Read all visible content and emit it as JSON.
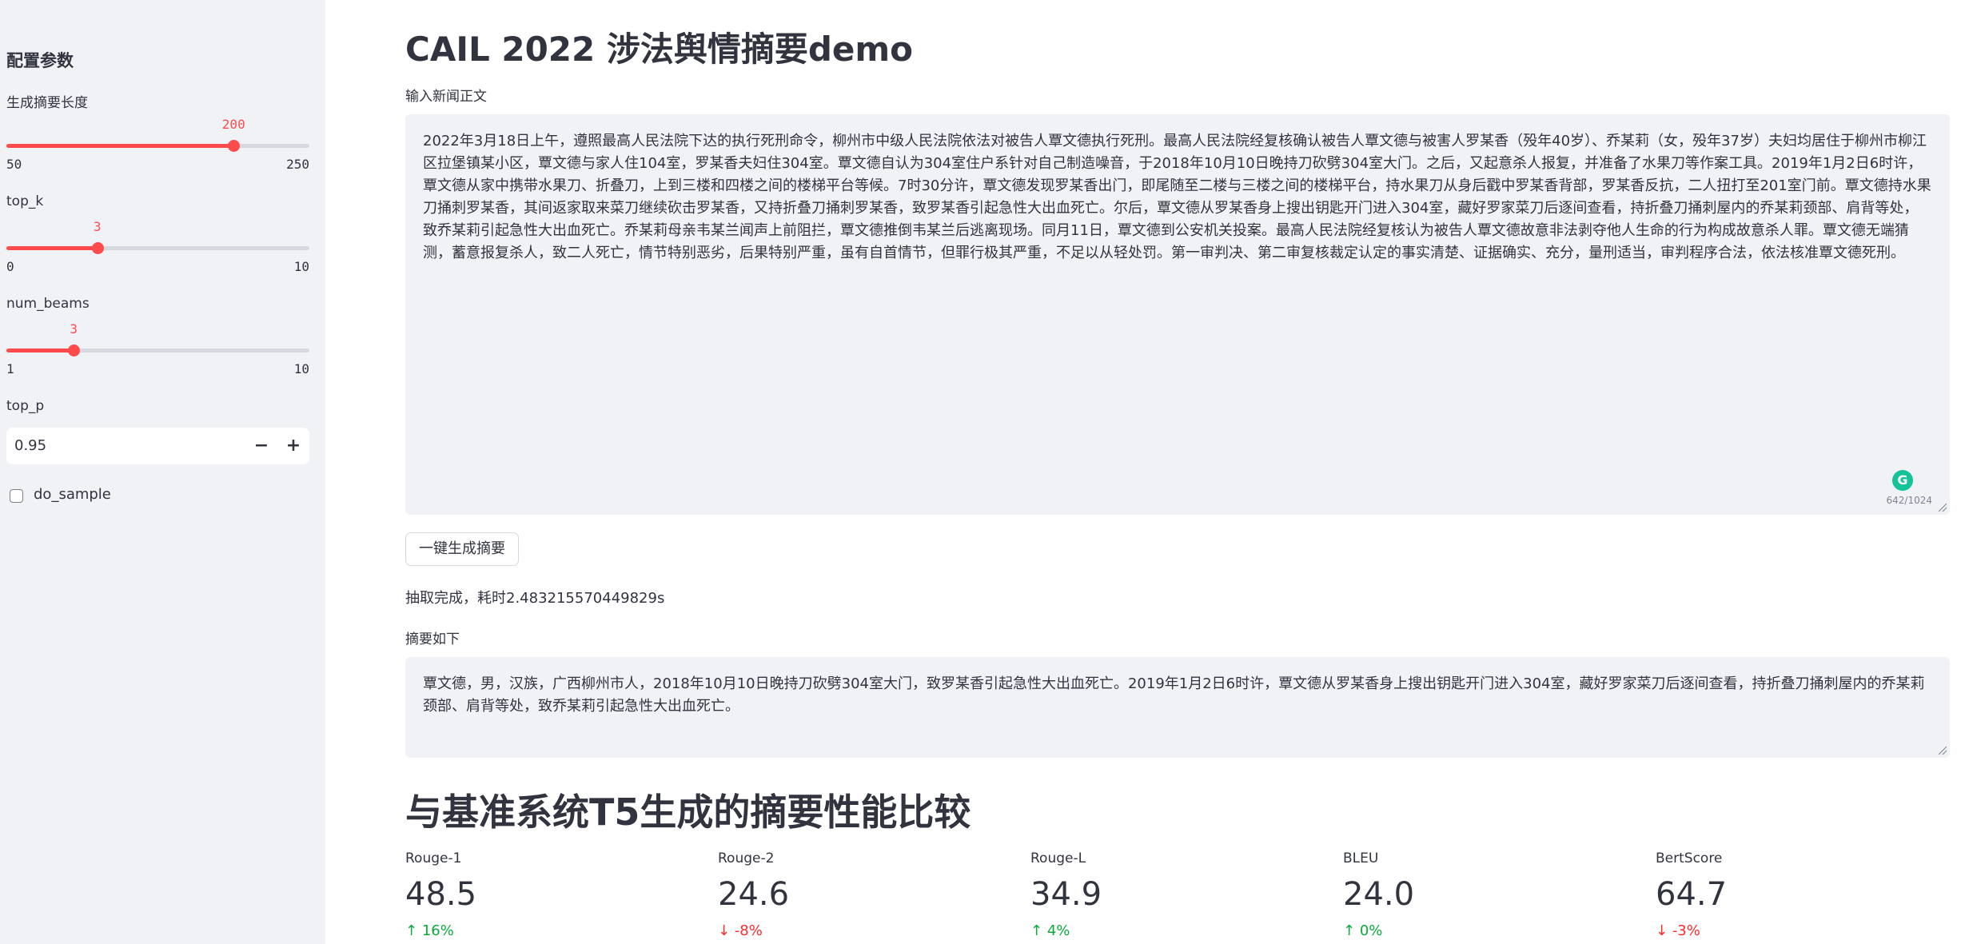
{
  "sidebar": {
    "title": "配置参数",
    "summary_length": {
      "label": "生成摘要长度",
      "min": 50,
      "max": 250,
      "value": 200
    },
    "top_k": {
      "label": "top_k",
      "min": 0,
      "max": 10,
      "value": 3
    },
    "num_beams": {
      "label": "num_beams",
      "min": 1,
      "max": 10,
      "value": 3
    },
    "top_p": {
      "label": "top_p",
      "value": "0.95",
      "minus": "−",
      "plus": "+"
    },
    "do_sample": {
      "label": "do_sample",
      "checked": false
    }
  },
  "main": {
    "title": "CAIL 2022 涉法舆情摘要demo",
    "input_label": "输入新闻正文",
    "input_text": "2022年3月18日上午，遵照最高人民法院下达的执行死刑命令，柳州市中级人民法院依法对被告人覃文德执行死刑。最高人民法院经复核确认被告人覃文德与被害人罗某香（殁年40岁）、乔某莉（女，殁年37岁）夫妇均居住于柳州市柳江区拉堡镇某小区，覃文德与家人住104室，罗某香夫妇住304室。覃文德自认为304室住户系针对自己制造噪音，于2018年10月10日晚持刀砍劈304室大门。之后，又起意杀人报复，并准备了水果刀等作案工具。2019年1月2日6时许，覃文德从家中携带水果刀、折叠刀，上到三楼和四楼之间的楼梯平台等候。7时30分许，覃文德发现罗某香出门，即尾随至二楼与三楼之间的楼梯平台，持水果刀从身后戳中罗某香背部，罗某香反抗，二人扭打至201室门前。覃文德持水果刀捅刺罗某香，其间返家取来菜刀继续砍击罗某香，又持折叠刀捅刺罗某香，致罗某香引起急性大出血死亡。尔后，覃文德从罗某香身上搜出钥匙开门进入304室，藏好罗家菜刀后逐间查看，持折叠刀捅刺屋内的乔某莉颈部、肩背等处，致乔某莉引起急性大出血死亡。乔某莉母亲韦某兰闻声上前阻拦，覃文德推倒韦某兰后逃离现场。同月11日，覃文德到公安机关投案。最高人民法院经复核认为被告人覃文德故意非法剥夺他人生命的行为构成故意杀人罪。覃文德无端猜测，蓄意报复杀人，致二人死亡，情节特别恶劣，后果特别严重，虽有自首情节，但罪行极其严重，不足以从轻处罚。第一审判决、第二审复核裁定认定的事实清楚、证据确实、充分，量刑适当，审判程序合法，依法核准覃文德死刑。",
    "char_counter": "642/1024",
    "generate_button": "一键生成摘要",
    "status_text": "抽取完成，耗时2.483215570449829s",
    "summary_label": "摘要如下",
    "summary_text": "覃文德，男，汉族，广西柳州市人，2018年10月10日晚持刀砍劈304室大门，致罗某香引起急性大出血死亡。2019年1月2日6时许，覃文德从罗某香身上搜出钥匙开门进入304室，藏好罗家菜刀后逐间查看，持折叠刀捅刺屋内的乔某莉颈部、肩背等处，致乔某莉引起急性大出血死亡。",
    "compare_title": "与基准系统T5生成的摘要性能比较",
    "metrics": [
      {
        "label": "Rouge-1",
        "value": "48.5",
        "delta": "16%",
        "direction": "up"
      },
      {
        "label": "Rouge-2",
        "value": "24.6",
        "delta": "-8%",
        "direction": "down"
      },
      {
        "label": "Rouge-L",
        "value": "34.9",
        "delta": "4%",
        "direction": "up"
      },
      {
        "label": "BLEU",
        "value": "24.0",
        "delta": "0%",
        "direction": "up"
      },
      {
        "label": "BertScore",
        "value": "64.7",
        "delta": "-3%",
        "direction": "down"
      }
    ]
  },
  "colors": {
    "accent": "#ff4b4b",
    "sidebar_bg": "#f0f2f6",
    "delta_up": "#09ab3b",
    "delta_down": "#ff2b2b",
    "grammarly": "#15c39a"
  },
  "icons": {
    "delta_up": "arrow-up-icon",
    "delta_down": "arrow-down-icon",
    "grammarly": "grammarly-icon",
    "resize": "resize-handle-icon"
  }
}
